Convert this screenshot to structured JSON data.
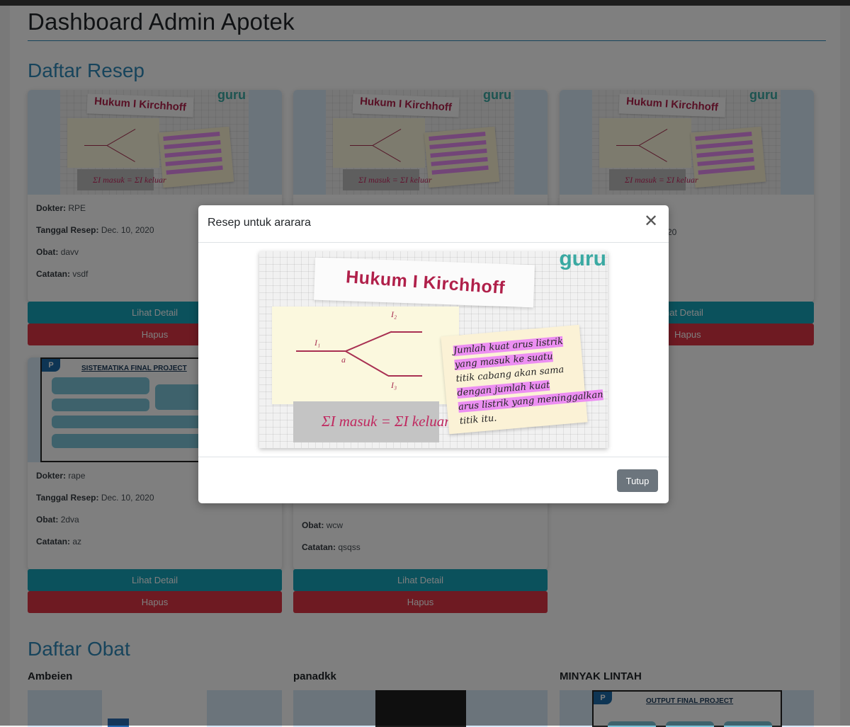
{
  "page": {
    "title": "Dashboard Admin Apotek"
  },
  "resep": {
    "section_title": "Daftar Resep",
    "labels": {
      "dokter": "Dokter:",
      "tanggal": "Tanggal Resep:",
      "obat": "Obat:",
      "catatan": "Catatan:"
    },
    "cards": [
      {
        "dokter": "RPE",
        "tanggal": "Dec. 10, 2020",
        "obat": "davv",
        "catatan": "vsdf",
        "image": "kirchhoff"
      },
      {
        "dokter": "",
        "tanggal": "",
        "obat": "",
        "catatan": "",
        "image": "kirchhoff"
      },
      {
        "dokter": "",
        "tanggal": "20",
        "obat": "",
        "catatan": "",
        "image": "kirchhoff"
      },
      {
        "dokter": "rape",
        "tanggal": "Dec. 10, 2020",
        "obat": "2dva",
        "catatan": "az",
        "image": "sistematika"
      },
      {
        "dokter": "",
        "tanggal": "",
        "obat": "wcw",
        "catatan": "qsqss",
        "image": ""
      }
    ],
    "detail_label": "Lihat Detail",
    "detail_label_partial": "hat Detail",
    "hapus_label": "Hapus"
  },
  "obat": {
    "section_title": "Daftar Obat",
    "items": [
      {
        "name": "Ambeien"
      },
      {
        "name": "panadkk"
      },
      {
        "name": "MINYAK LINTAH"
      }
    ],
    "output_title": "OUTPUT FINAL PROJECT"
  },
  "thumb": {
    "kirchhoff_title": "Hukum I Kirchhoff",
    "logo": "guru",
    "formula": "ΣI masuk = ΣI keluar",
    "sistematika_title": "SISTEMATIKA FINAL PROJECT",
    "p_logo": "P"
  },
  "modal": {
    "title": "Resep untuk ararara",
    "close_icon": "close-icon",
    "tutup_label": "Tutup",
    "image": {
      "title": "Hukum I Kirchhoff",
      "logo": "guru",
      "formula": "ΣI masuk = ΣI keluar",
      "label_i1": "I₁",
      "label_i2": "I₂",
      "label_i3": "I₃",
      "label_a": "a",
      "note_lines": [
        "Jumlah kuat arus listrik",
        "yang masuk ke suatu",
        "titik cabang akan sama",
        "dengan  jumlah kuat",
        "arus listrik yang meninggalkan",
        "titik itu."
      ]
    }
  },
  "colors": {
    "heading_blue": "#2f89b8",
    "detail_button": "#17a2b8",
    "hapus_button": "#dc3545",
    "tutup_button": "#6c757d",
    "kirchhoff_red": "#b0204a",
    "highlight_pink": "#ec8ff2"
  }
}
